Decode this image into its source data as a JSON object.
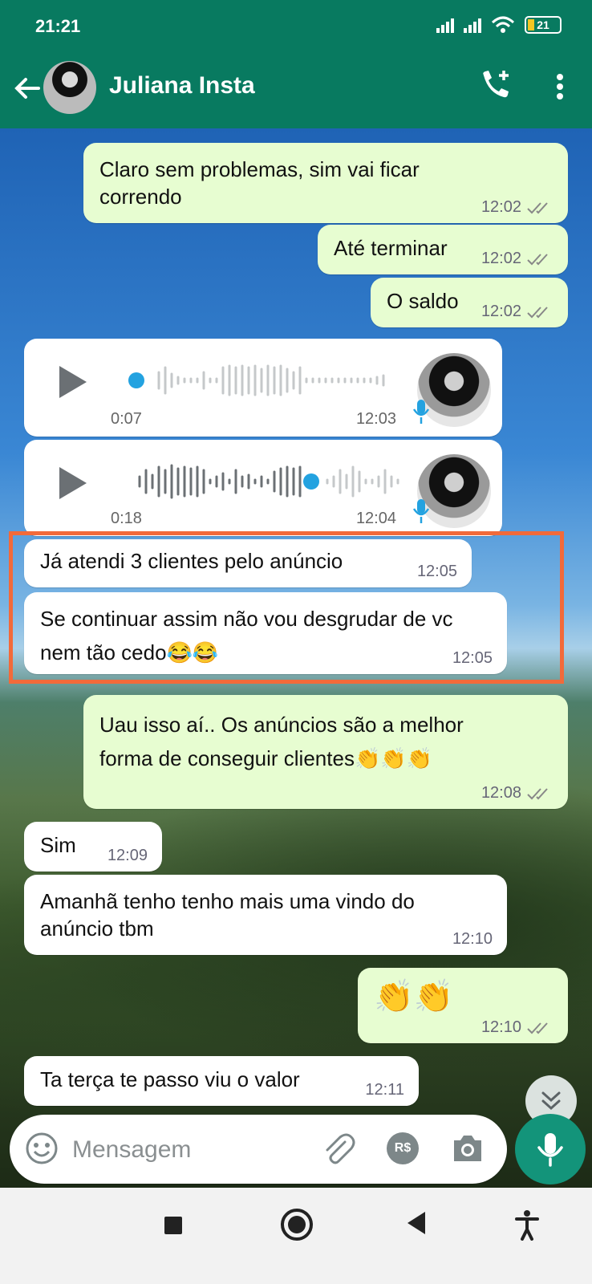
{
  "status_bar": {
    "time": "21:21",
    "battery": "21"
  },
  "header": {
    "contact_name": "Juliana Insta"
  },
  "messages": [
    {
      "text": "Claro sem problemas, sim vai ficar correndo",
      "time": "12:02"
    },
    {
      "text": "Até terminar",
      "time": "12:02"
    },
    {
      "text": "O saldo",
      "time": "12:02"
    },
    {
      "duration": "0:07",
      "time": "12:03"
    },
    {
      "duration": "0:18",
      "time": "12:04"
    },
    {
      "text": "Já atendi 3 clientes pelo anúncio",
      "time": "12:05"
    },
    {
      "text": "Se continuar assim não vou desgrudar de vc nem tão cedo😂😂",
      "time": "12:05"
    },
    {
      "text": "Uau isso aí.. Os anúncios são a melhor forma de conseguir clientes👏👏👏",
      "time": "12:08"
    },
    {
      "text": "Sim",
      "time": "12:09"
    },
    {
      "text": "Amanhã tenho tenho mais uma vindo do anúncio tbm",
      "time": "12:10"
    },
    {
      "text": "👏👏",
      "time": "12:10"
    },
    {
      "text": "Ta terça te passo viu o valor",
      "time": "12:11"
    }
  ],
  "composer": {
    "placeholder": "Mensagem",
    "pay_label": "R$"
  },
  "colors": {
    "header": "#087a60",
    "outgoing": "#e7fdd1",
    "incoming": "#ffffff",
    "accent": "#13947a",
    "highlight": "#f26a3a"
  }
}
